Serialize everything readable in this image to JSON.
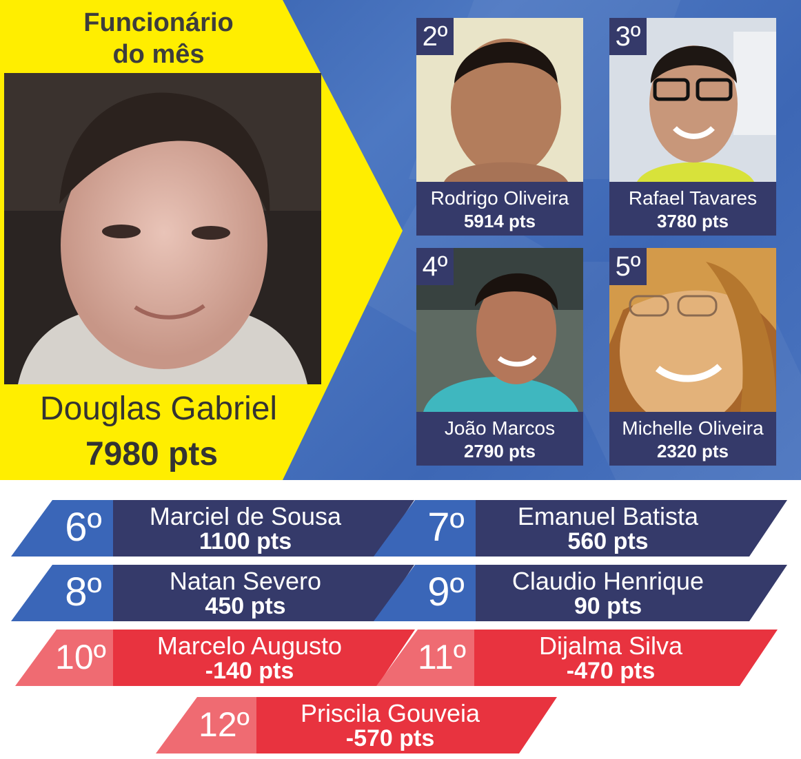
{
  "colors": {
    "panel_blue": "#3d67b5",
    "highlight_yellow": "#ffee00",
    "navy": "#353a6a",
    "rank_blue": "#3a66b8",
    "negative_red": "#e8333f",
    "negative_rank_pink": "#ef6b72"
  },
  "winner": {
    "title_line1": "Funcionário",
    "title_line2": "do mês",
    "name": "Douglas Gabriel",
    "score": "7980 pts"
  },
  "runners": [
    {
      "rank": "2º",
      "name": "Rodrigo Oliveira",
      "score": "5914 pts"
    },
    {
      "rank": "3º",
      "name": "Rafael Tavares",
      "score": "3780 pts"
    },
    {
      "rank": "4º",
      "name": "João Marcos",
      "score": "2790 pts"
    },
    {
      "rank": "5º",
      "name": "Michelle Oliveira",
      "score": "2320 pts"
    }
  ],
  "ranking": [
    {
      "rank": "6º",
      "name": "Marciel de Sousa",
      "score": "1100 pts"
    },
    {
      "rank": "7º",
      "name": "Emanuel Batista",
      "score": "560 pts"
    },
    {
      "rank": "8º",
      "name": "Natan Severo",
      "score": "450 pts"
    },
    {
      "rank": "9º",
      "name": "Claudio Henrique",
      "score": "90 pts"
    },
    {
      "rank": "10º",
      "name": "Marcelo Augusto",
      "score": "-140 pts"
    },
    {
      "rank": "11º",
      "name": "Dijalma Silva",
      "score": "-470 pts"
    },
    {
      "rank": "12º",
      "name": "Priscila Gouveia",
      "score": "-570 pts"
    }
  ]
}
